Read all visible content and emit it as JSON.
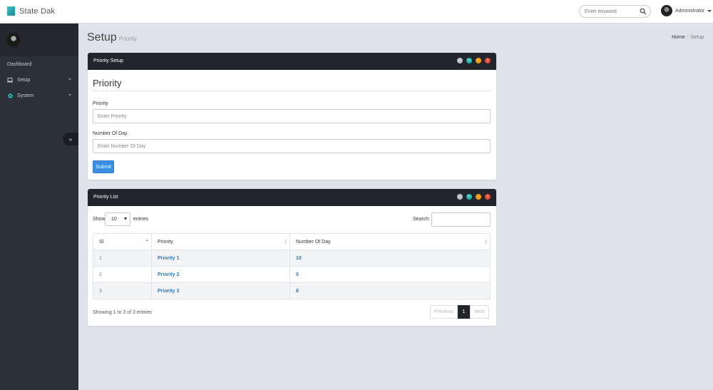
{
  "app": {
    "brand": "State Dak"
  },
  "topbar": {
    "search_placeholder": "Enter keyword",
    "user_name": "Administrator"
  },
  "sidebar": {
    "items": [
      {
        "label": "Dashboard",
        "icon": "none"
      },
      {
        "label": "Setup",
        "icon": "laptop-icon"
      },
      {
        "label": "System",
        "icon": "gear-icon"
      }
    ]
  },
  "page": {
    "title": "Setup",
    "subtitle": "Priority",
    "breadcrumb": [
      "Home",
      "Setup"
    ]
  },
  "setup_panel": {
    "title": "Priority Setup",
    "heading": "Priority",
    "priority_label": "Priority",
    "priority_placeholder": "Enter Priority",
    "days_label": "Number Of Day",
    "days_placeholder": "Enter Number Of Day",
    "submit_label": "Submit",
    "tool_colors": {
      "check": "#b9c0c8",
      "refresh": "#1fb5ac",
      "minimize": "#f39c12",
      "close": "#e74c3c"
    }
  },
  "list_panel": {
    "title": "Priority List",
    "show_label": "Show",
    "entries_label": "entries",
    "page_length": "10",
    "search_label": "Search:",
    "columns": [
      "Sl",
      "Priority",
      "Number Of Day"
    ],
    "rows": [
      {
        "sl": "1",
        "priority": "Priority 1",
        "days": "10"
      },
      {
        "sl": "2",
        "priority": "Priority 2",
        "days": "5"
      },
      {
        "sl": "3",
        "priority": "Priority 3",
        "days": "8"
      }
    ],
    "info": "Showing 1 to 3 of 3 entries",
    "pagination": {
      "previous": "Previous",
      "current": "1",
      "next": "Next"
    }
  }
}
